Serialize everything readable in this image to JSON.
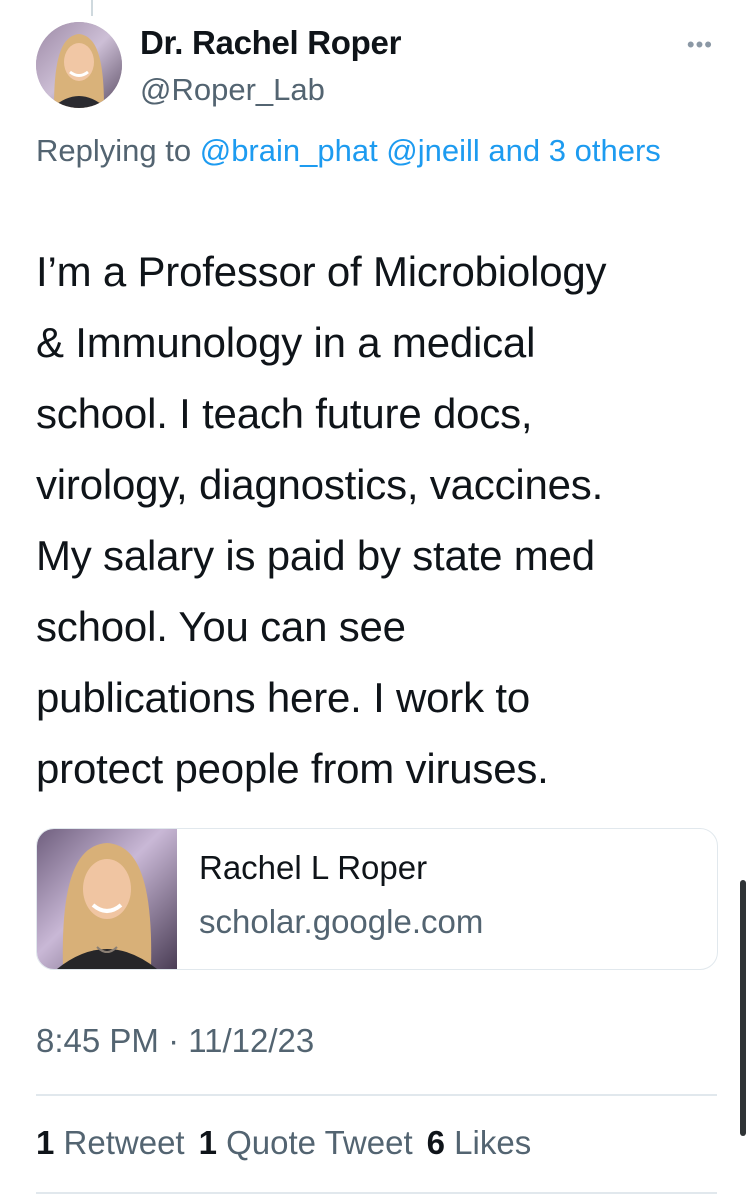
{
  "tweet": {
    "display_name": "Dr. Rachel Roper",
    "handle": "@Roper_Lab",
    "more_label": "•••",
    "reply_prefix": "Replying to ",
    "reply_mentions": "@brain_phat @jneill and 3 others",
    "text": "I’m a Professor of Microbiology\n& Immunology in a medical\nschool. I teach future docs,\nvirology, diagnostics, vaccines.\nMy salary is paid by state med\nschool. You can see\npublications here. I work to\nprotect people from viruses.",
    "timestamp": "8:45 PM · 11/12/23"
  },
  "link_card": {
    "title": "Rachel L Roper",
    "domain": "scholar.google.com"
  },
  "stats": {
    "retweets_count": "1",
    "retweets_label": "Retweet",
    "quotes_count": "1",
    "quotes_label": "Quote Tweet",
    "likes_count": "6",
    "likes_label": "Likes"
  },
  "colors": {
    "link_blue": "#1d9bf0",
    "secondary_text": "#536471",
    "primary_text": "#0f1419",
    "border": "#e1e8ed"
  }
}
